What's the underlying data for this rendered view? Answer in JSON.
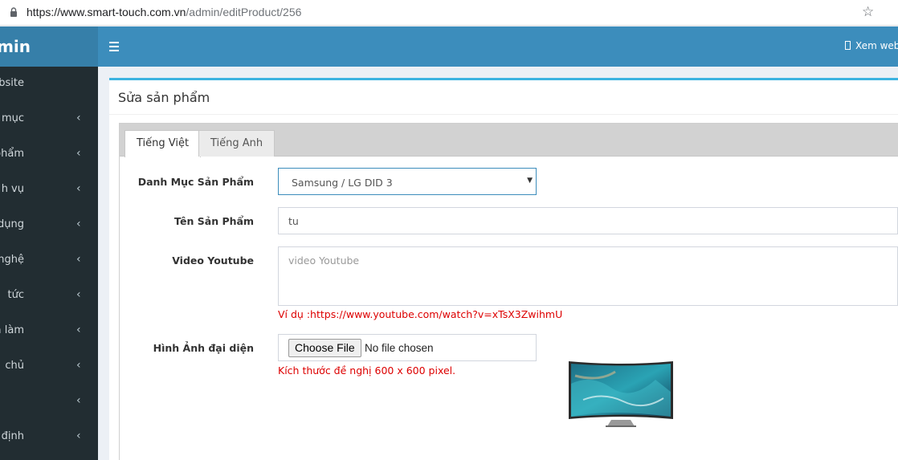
{
  "browser": {
    "url_host": "https://www.smart-touch.com.vn",
    "url_path": "/admin/editProduct/256"
  },
  "sidebar": {
    "logo": "dmin",
    "items": [
      {
        "label": "ebsite",
        "chevron": false
      },
      {
        "label": "nh mục",
        "chevron": true
      },
      {
        "label": "ả phẩm",
        "chevron": true
      },
      {
        "label": "h vụ",
        "chevron": true
      },
      {
        "label": "ển dụng",
        "chevron": true
      },
      {
        "label": "công nghệ",
        "chevron": true
      },
      {
        "label": "tức",
        "chevron": true
      },
      {
        "label": "án đã làm",
        "chevron": true
      },
      {
        "label": "chủ",
        "chevron": true
      },
      {
        "label": "",
        "chevron": true
      },
      {
        "label": "định",
        "chevron": true
      }
    ],
    "chevron_glyph": "‹"
  },
  "topnav": {
    "view_site": "Xem web"
  },
  "box": {
    "title": "Sửa sản phẩm"
  },
  "tabs": [
    {
      "label": "Tiếng Việt",
      "active": true
    },
    {
      "label": "Tiếng Anh",
      "active": false
    }
  ],
  "form": {
    "category_label": "Danh Mục Sản Phẩm",
    "category_value": "Samsung / LG DID 3",
    "name_label": "Tên Sản Phẩm",
    "name_value": "tu",
    "video_label": "Video Youtube",
    "video_placeholder": "video Youtube",
    "video_hint": "Ví dụ :https://www.youtube.com/watch?v=xTsX3ZwihmU",
    "image_label": "Hình Ảnh đại diện",
    "file_button": "Choose File",
    "file_status": "No file chosen",
    "image_hint": "Kích thước đề nghị 600 x 600 pixel."
  },
  "colors": {
    "sidebar_bg": "#222d32",
    "logo_bg": "#367fa9",
    "header_bg": "#3c8dbc",
    "box_accent": "#3cb3e0",
    "hint_red": "#dd0000"
  },
  "icons": {
    "lock": "lock-icon",
    "star": "star-icon",
    "menu": "hamburger-icon",
    "external": "external-link-icon",
    "dropdown": "caret-down-icon"
  }
}
